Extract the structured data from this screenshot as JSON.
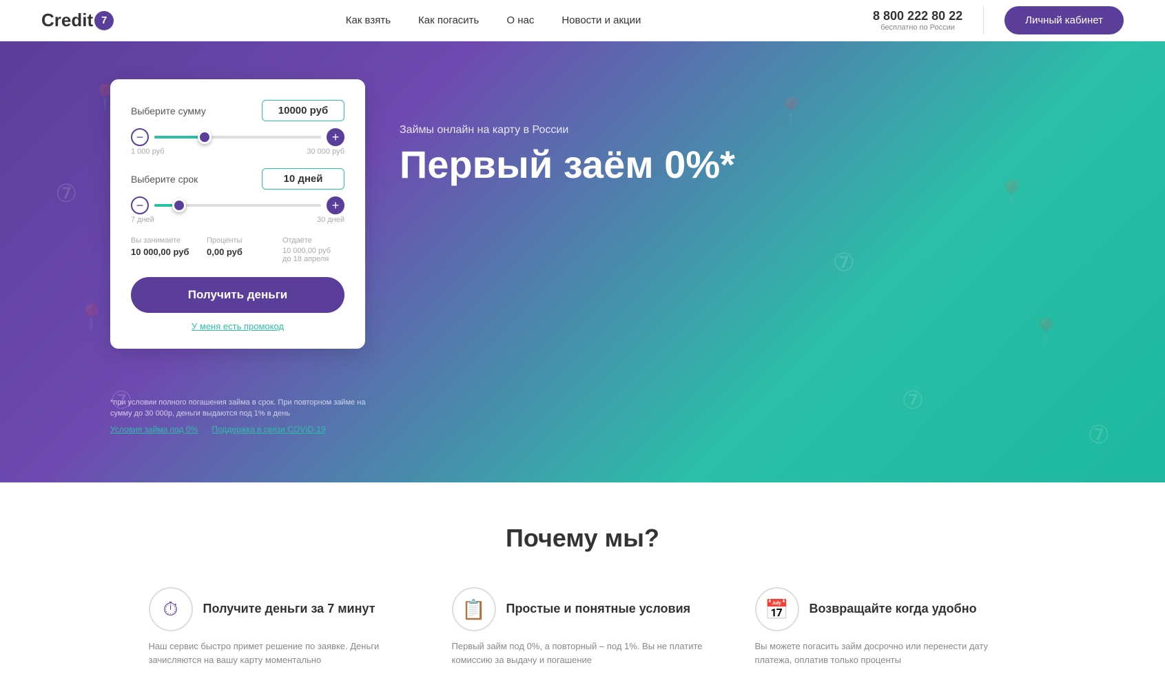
{
  "header": {
    "logo_text": "Credit",
    "logo_number": "7",
    "nav": [
      {
        "label": "Как взять",
        "href": "#"
      },
      {
        "label": "Как погасить",
        "href": "#"
      },
      {
        "label": "О нас",
        "href": "#"
      },
      {
        "label": "Новости и акции",
        "href": "#"
      }
    ],
    "phone": "8 800 222 80 22",
    "phone_sub": "бесплатно по России",
    "cabinet_btn": "Личный кабинет"
  },
  "hero": {
    "subtitle": "Займы онлайн на карту в России",
    "title": "Первый заём 0%*"
  },
  "loan_form": {
    "amount_label": "Выберите сумму",
    "amount_value": "10000 руб",
    "amount_min": "1 000 руб",
    "amount_max": "30 000 руб",
    "amount_percent": 30,
    "term_label": "Выберите срок",
    "term_value": "10 дней",
    "term_min": "7 дней",
    "term_max": "30 дней",
    "term_percent": 15,
    "summary": {
      "borrow_label": "Вы занимаете",
      "borrow_value": "10 000,00 руб",
      "interest_label": "Проценты",
      "interest_value": "0,00 руб",
      "return_label": "Отдаёте",
      "return_value": "10 000,00 руб",
      "return_date": "до 18 апреля"
    },
    "get_money_btn": "Получить деньги",
    "promo_link": "У меня есть промокод"
  },
  "disclaimer": {
    "text": "*при условии полного погашения займа в срок. При повторном займе на сумму до 30 000р, деньги выдаются под 1% в день",
    "link1": "Условия займа под 0%",
    "link2": "Поддержка в связи COVID-19"
  },
  "why_section": {
    "title": "Почему мы?",
    "cards": [
      {
        "icon": "⏱",
        "title": "Получите деньги за 7 минут",
        "text": "Наш сервис быстро примет решение по заявке. Деньги зачисляются на вашу карту моментально"
      },
      {
        "icon": "📋",
        "title": "Простые и понятные условия",
        "text": "Первый займ под 0%, а повторный – под 1%. Вы не платите комиссию за выдачу и погашение"
      },
      {
        "icon": "📅",
        "title": "Возвращайте когда удобно",
        "text": "Вы можете погасить займ досрочно или перенести дату платежа, оплатив только проценты"
      }
    ]
  }
}
